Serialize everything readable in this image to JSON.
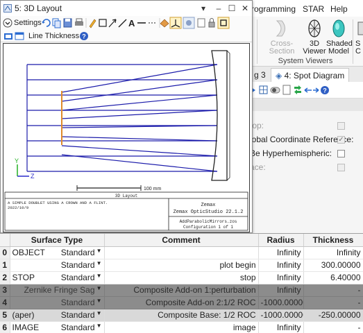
{
  "ribbon": {
    "tabs": [
      "rogramming",
      "STAR",
      "Help"
    ],
    "buttons": [
      {
        "label1": "Cross-Section",
        "label2": "",
        "enabled": false
      },
      {
        "label1": "3D",
        "label2": "Viewer",
        "enabled": true
      },
      {
        "label1": "Shaded",
        "label2": "Model",
        "enabled": true
      },
      {
        "label1": "S",
        "label2": "C",
        "enabled": true
      }
    ],
    "group_label": "System Viewers"
  },
  "doc_tabs": [
    {
      "label": "g 3"
    },
    {
      "label": "4: Spot Diagram"
    }
  ],
  "properties": [
    {
      "label": "top:",
      "checked": false,
      "enabled": false
    },
    {
      "label": "lobal Coordinate Reference:",
      "checked": true,
      "enabled": false
    },
    {
      "label": "Be Hyperhemispheric:",
      "checked": false,
      "enabled": true
    },
    {
      "label": "ace:",
      "checked": false,
      "enabled": false
    }
  ],
  "layout_window": {
    "title": "5: 3D Layout",
    "settings_label": "Settings",
    "line_thickness_label": "Line Thickness",
    "scale_bar_label": "100 mm",
    "caption": "3D Layout",
    "notes_line1": "A SIMPLE DOUBLET USING A CROWN AND A FLINT.",
    "notes_line2": "2022/10/9",
    "product_line1": "Zemax",
    "product_line2": "Zemax OpticStudio 22.1.2",
    "file_name": "AddParabolicMirrors.zos",
    "configuration": "Configuration 1 of 1",
    "axis_y": "Y",
    "axis_z": "Z",
    "colors": {
      "rays_blue": "#1a1aaa",
      "rays_orange": "#e08a2a",
      "axis_green": "#22b022"
    }
  },
  "lens_editor": {
    "columns": [
      "Surface Type",
      "Comment",
      "Radius",
      "Thickness"
    ],
    "rows": [
      {
        "index": "0",
        "name": "OBJECT",
        "type": "Standard",
        "comment": "",
        "radius": "Infinity",
        "thickness": "Infinity",
        "style": "normal"
      },
      {
        "index": "1",
        "name": "",
        "type": "Standard",
        "comment": "plot begin",
        "radius": "Infinity",
        "thickness": "300.00000",
        "style": "normal"
      },
      {
        "index": "2",
        "name": "STOP",
        "type": "Standard",
        "comment": "stop",
        "radius": "Infinity",
        "thickness": "6.40000",
        "style": "normal"
      },
      {
        "index": "3",
        "name": "",
        "type": "Zernike Fringe Sag",
        "comment": "Composite Add-on 1:perturbation",
        "radius": "Infinity",
        "thickness": "-",
        "style": "aux"
      },
      {
        "index": "4",
        "name": "",
        "type": "Standard",
        "comment": "Composite Add-on 2:1/2 ROC",
        "radius": "-1000.00000",
        "thickness": "-",
        "style": "aux"
      },
      {
        "index": "5",
        "name": "(aper)",
        "type": "Standard",
        "comment": "Composite Base: 1/2 ROC",
        "radius": "-1000.00000",
        "thickness": "-250.00000",
        "style": "selected"
      },
      {
        "index": "6",
        "name": "IMAGE",
        "type": "Standard",
        "comment": "image",
        "radius": "Infinity",
        "thickness": "-",
        "style": "normal"
      }
    ]
  }
}
